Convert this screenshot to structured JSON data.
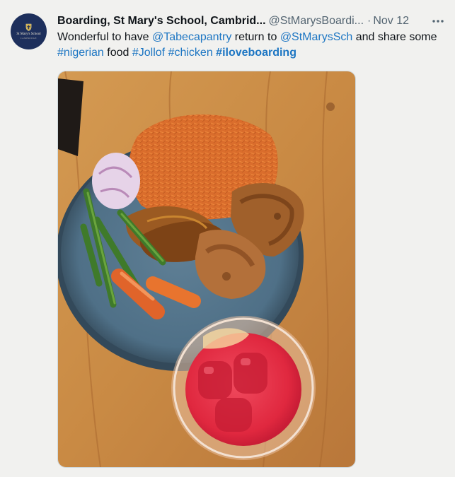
{
  "tweet": {
    "avatar": {
      "school_name": "St Mary's School",
      "school_sub": "CAMBRIDGE"
    },
    "display_name": "Boarding, St Mary's School, Cambrid...",
    "handle": "@StMarysBoardi...",
    "separator": "·",
    "date": "Nov 12",
    "more_icon": "ellipsis-horizontal",
    "text": {
      "t1": "Wonderful to have ",
      "mention1": "@Tabecapantry",
      "t2": " return to ",
      "mention2": "@StMarysSch",
      "t3": " and share some ",
      "tag1": "#nigerian",
      "t4": " food ",
      "tag2": "#Jollof",
      "t5": " ",
      "tag3": "#chicken",
      "t6": " ",
      "tag4": "#iloveboarding"
    },
    "link_color": "#1d76c3"
  }
}
